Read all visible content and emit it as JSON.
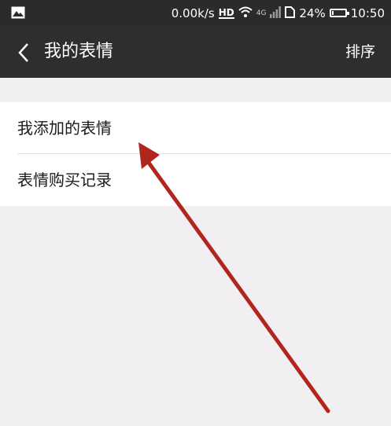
{
  "status_bar": {
    "net_speed": "0.00k/s",
    "hd_label": "HD",
    "network_label": "4G",
    "battery_percent": "24%",
    "battery_level": 0.24,
    "time": "10:50",
    "icons": [
      "image-icon",
      "wifi-icon",
      "signal-icon",
      "sim-icon",
      "battery-icon"
    ]
  },
  "title_bar": {
    "title": "我的表情",
    "sort_label": "排序",
    "back_icon": "chevron-left-icon"
  },
  "menu": {
    "items": [
      {
        "label": "我添加的表情"
      },
      {
        "label": "表情购买记录"
      }
    ]
  },
  "colors": {
    "status_bar_bg": "#2b2b2b",
    "title_bar_bg": "#2e2e2e",
    "page_bg": "#f2eff2",
    "list_bg": "#ffffff",
    "annotation_arrow": "#b0261f"
  }
}
